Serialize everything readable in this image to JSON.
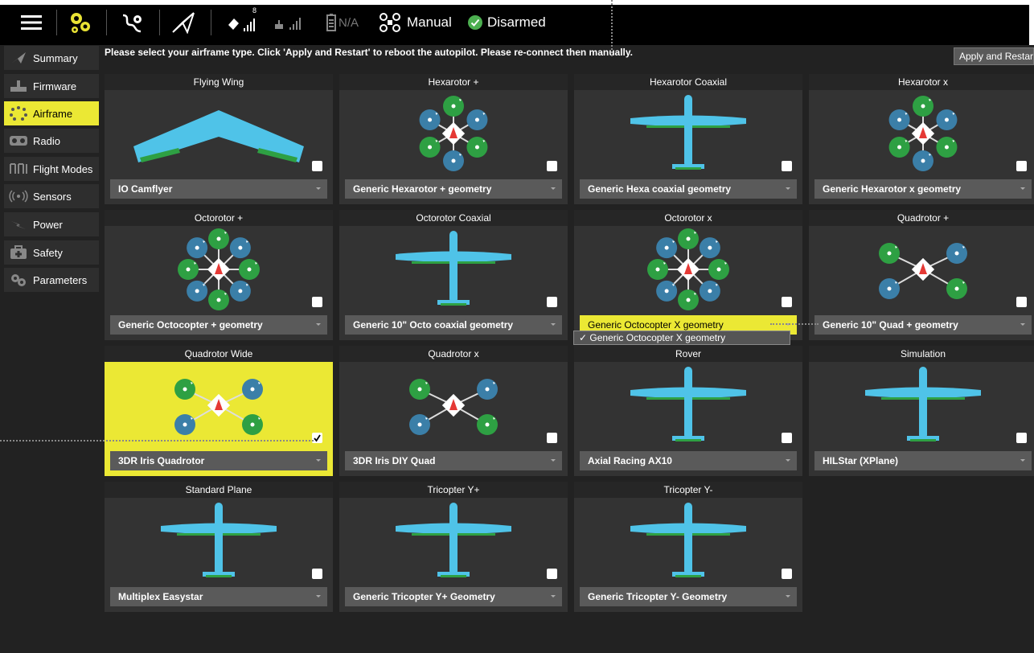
{
  "toolbar": {
    "satellite_count": "8",
    "battery_text": "N/A",
    "flight_mode": "Manual",
    "arm_status": "Disarmed"
  },
  "sidebar": {
    "items": [
      {
        "label": "Summary",
        "icon": "paper-plane-icon"
      },
      {
        "label": "Firmware",
        "icon": "download-icon"
      },
      {
        "label": "Airframe",
        "icon": "airframe-dots-icon",
        "active": true
      },
      {
        "label": "Radio",
        "icon": "radio-icon"
      },
      {
        "label": "Flight Modes",
        "icon": "flight-modes-icon"
      },
      {
        "label": "Sensors",
        "icon": "sensor-waves-icon"
      },
      {
        "label": "Power",
        "icon": "power-bolt-icon"
      },
      {
        "label": "Safety",
        "icon": "first-aid-icon"
      },
      {
        "label": "Parameters",
        "icon": "gears-icon"
      }
    ]
  },
  "main": {
    "instruction": "Please select your airframe type. Click 'Apply and Restart' to reboot the autopilot. Please re-connect then manually.",
    "apply_button": "Apply and Restart",
    "popup_item": "✓ Generic Octocopter X geometry"
  },
  "airframes": [
    {
      "title": "Flying Wing",
      "selection": "IO Camflyer",
      "art": "wing"
    },
    {
      "title": "Hexarotor +",
      "selection": "Generic Hexarotor + geometry",
      "art": "hex"
    },
    {
      "title": "Hexarotor Coaxial",
      "selection": "Generic Hexa coaxial geometry",
      "art": "plane"
    },
    {
      "title": "Hexarotor x",
      "selection": "Generic Hexarotor x geometry",
      "art": "hex"
    },
    {
      "title": "Octorotor +",
      "selection": "Generic Octocopter + geometry",
      "art": "octo"
    },
    {
      "title": "Octorotor Coaxial",
      "selection": "Generic 10\" Octo coaxial geometry",
      "art": "plane"
    },
    {
      "title": "Octorotor x",
      "selection": "Generic Octocopter X geometry",
      "art": "octo",
      "highlighted": true
    },
    {
      "title": "Quadrotor +",
      "selection": "Generic 10\" Quad + geometry",
      "art": "quad"
    },
    {
      "title": "Quadrotor Wide",
      "selection": "3DR Iris Quadrotor",
      "art": "quad",
      "selected": true
    },
    {
      "title": "Quadrotor x",
      "selection": "3DR Iris DIY Quad",
      "art": "quad"
    },
    {
      "title": "Rover",
      "selection": "Axial Racing AX10",
      "art": "plane"
    },
    {
      "title": "Simulation",
      "selection": "HILStar (XPlane)",
      "art": "plane"
    },
    {
      "title": "Standard Plane",
      "selection": "Multiplex Easystar",
      "art": "plane"
    },
    {
      "title": "Tricopter Y+",
      "selection": "Generic Tricopter Y+ Geometry",
      "art": "plane"
    },
    {
      "title": "Tricopter Y-",
      "selection": "Generic Tricopter Y- Geometry",
      "art": "plane"
    }
  ],
  "colors": {
    "accent_yellow": "#ebe834",
    "airframe_blue": "#4fc3e8",
    "airframe_green": "#2ea043",
    "rotor_teal": "#3b7fa8",
    "disarmed_green": "#4caf50"
  }
}
